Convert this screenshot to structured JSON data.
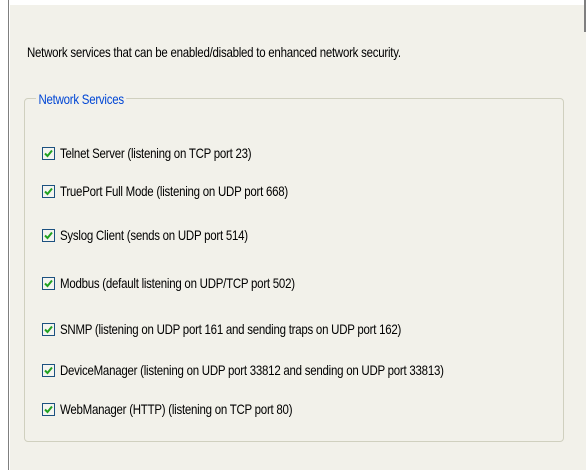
{
  "description": "Network services that can be enabled/disabled to enhanced network security.",
  "group": {
    "title": "Network Services",
    "services": [
      {
        "label": "Telnet Server (listening on TCP port 23)",
        "checked": true
      },
      {
        "label": "TruePort Full Mode (listening on UDP port 668)",
        "checked": true
      },
      {
        "label": "Syslog Client (sends on UDP port 514)",
        "checked": true
      },
      {
        "label": "Modbus (default listening on UDP/TCP port 502)",
        "checked": true
      },
      {
        "label": "SNMP (listening on UDP port 161 and sending traps on UDP port 162)",
        "checked": true
      },
      {
        "label": "DeviceManager (listening on UDP port 33812 and sending on UDP port 33813)",
        "checked": true
      },
      {
        "label": "WebManager (HTTP) (listening on TCP port 80)",
        "checked": true
      }
    ]
  },
  "colors": {
    "background": "#f2f1ea",
    "group_title": "#0046d5",
    "checkmark": "#21a121",
    "checkbox_border": "#1c5180"
  },
  "icons": {
    "check": "checkmark-icon"
  }
}
